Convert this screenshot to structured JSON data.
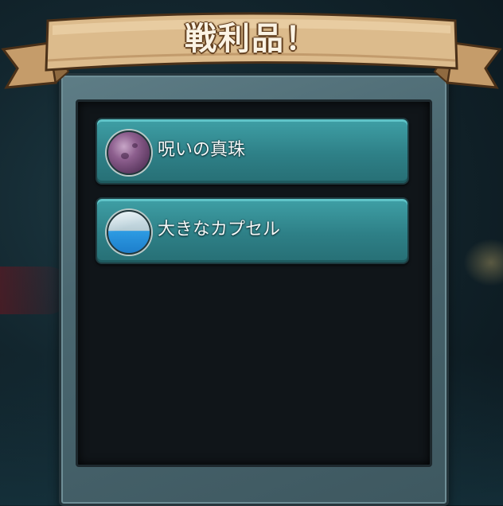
{
  "dialog": {
    "title": "戦利品！"
  },
  "loot": {
    "items": [
      {
        "label": "呪いの真珠",
        "icon": "cursed-pearl-icon"
      },
      {
        "label": "大きなカプセル",
        "icon": "large-capsule-icon"
      }
    ]
  },
  "colors": {
    "banner": "#d9b88a",
    "item_bg": "#2e8087",
    "frame": "#4a6770",
    "panel": "#101519"
  }
}
